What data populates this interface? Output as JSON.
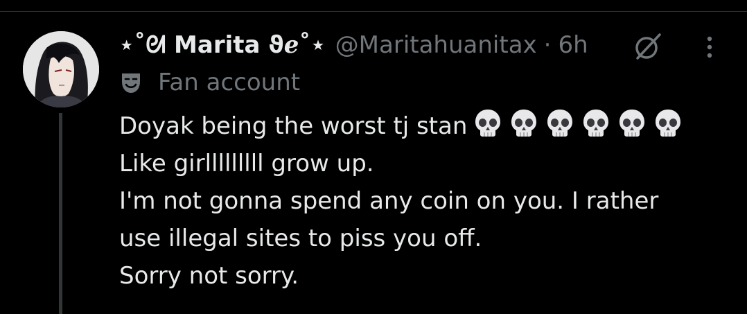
{
  "tweet": {
    "display_name": "⋆˚ᘛ Marita ϑℯ˚⋆",
    "handle": "@Maritahuanitax",
    "separator": "·",
    "time": "6h",
    "account_label": "Fan account",
    "lines": [
      "Doyak being the worst tj stan",
      "Like girlllllllll grow up.",
      "I'm not gonna spend any coin on you. I rather",
      "use illegal sites to piss you off.",
      "Sorry not sorry."
    ],
    "emoji": {
      "name": "skull",
      "count": 6
    }
  },
  "colors": {
    "background": "#000000",
    "text_primary": "#e7e9ea",
    "text_secondary": "#71767b",
    "thread_line": "#333639"
  },
  "icons": {
    "grok": "grok-icon",
    "more": "more-icon",
    "label": "theater-masks-icon"
  }
}
